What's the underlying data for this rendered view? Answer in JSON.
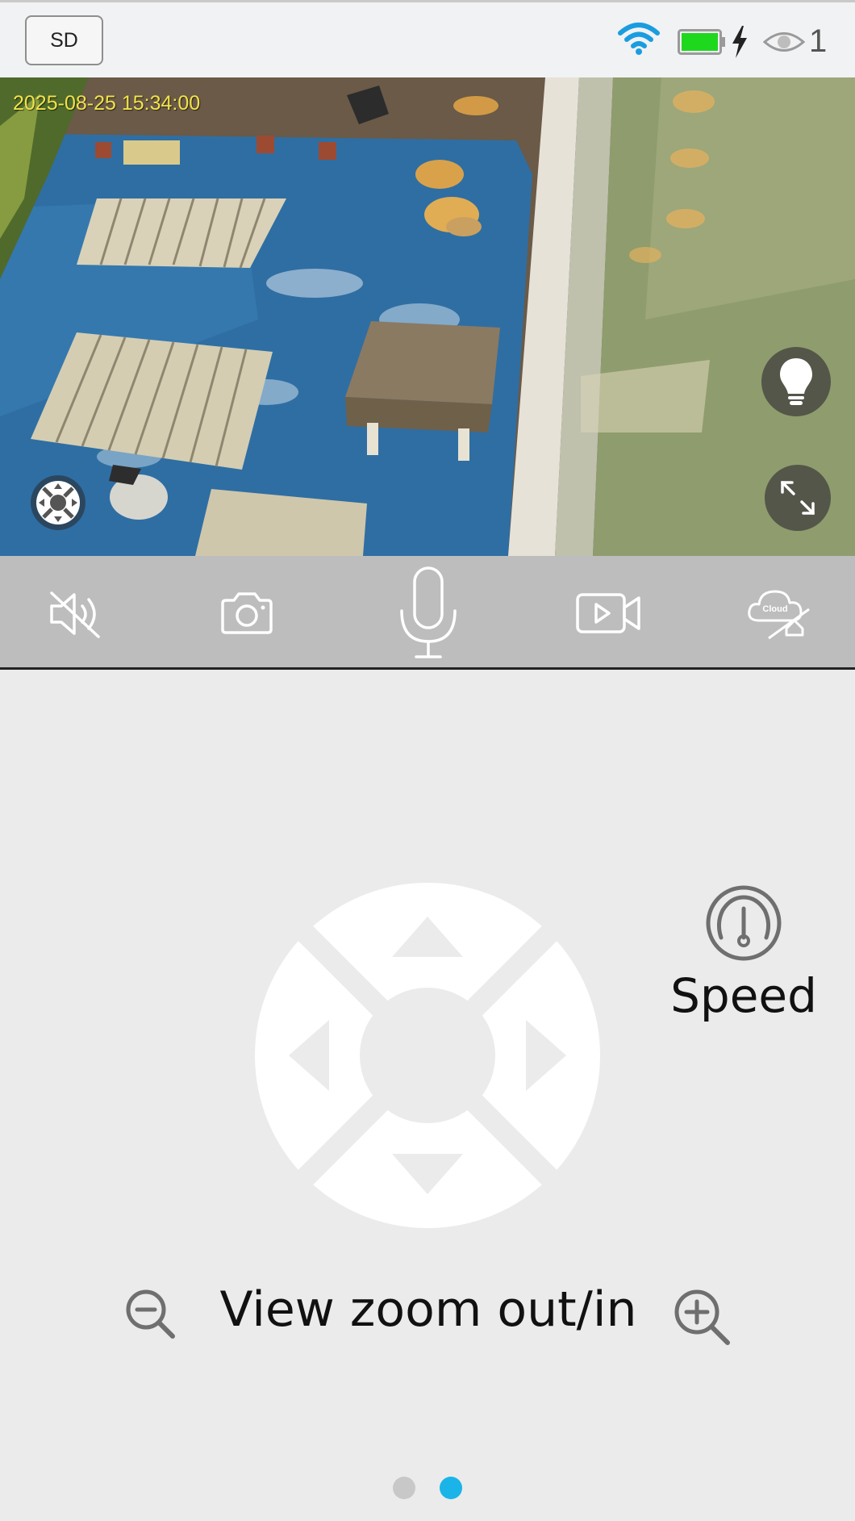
{
  "top_bar": {
    "quality_label": "SD",
    "viewer_count": "1",
    "colors": {
      "wifi": "#1a9de0",
      "battery": "#1ed81e"
    }
  },
  "video": {
    "timestamp": "2025-08-25 15:34:00"
  },
  "toolbar": {
    "cloud_label": "Cloud"
  },
  "controls": {
    "speed_label": "Speed",
    "zoom_label": "View zoom out/in"
  },
  "pager": {
    "count": 2,
    "active": 2,
    "active_color": "#1ab4e8"
  }
}
